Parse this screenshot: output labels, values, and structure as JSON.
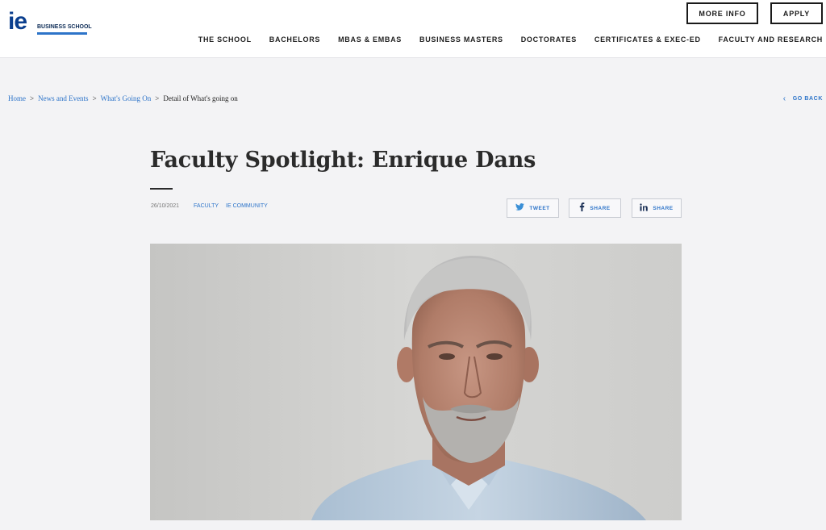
{
  "header": {
    "logo_text": "ie",
    "logo_subtitle": "BUSINESS SCHOOL",
    "more_info": "MORE INFO",
    "apply": "APPLY",
    "nav": [
      "THE SCHOOL",
      "BACHELORS",
      "MBAS & EMBAS",
      "BUSINESS MASTERS",
      "DOCTORATES",
      "CERTIFICATES & EXEC-ED",
      "FACULTY AND RESEARCH"
    ]
  },
  "breadcrumb": {
    "items": [
      "Home",
      "News and Events",
      "What's Going On"
    ],
    "separator": ">",
    "current": "Detail of What's going on"
  },
  "go_back": "GO BACK",
  "article": {
    "title": "Faculty Spotlight: Enrique Dans",
    "date": "26/10/2021",
    "tags": [
      "FACULTY",
      "IE COMMUNITY"
    ],
    "share": {
      "tweet": "TWEET",
      "facebook": "SHARE",
      "linkedin": "SHARE"
    }
  },
  "icons": {
    "twitter": "twitter-icon",
    "facebook": "facebook-icon",
    "linkedin": "linkedin-icon",
    "back": "chevron-left-icon"
  },
  "colors": {
    "link": "#2d74c9",
    "brand": "#0b3f8e",
    "background": "#f3f3f5"
  }
}
